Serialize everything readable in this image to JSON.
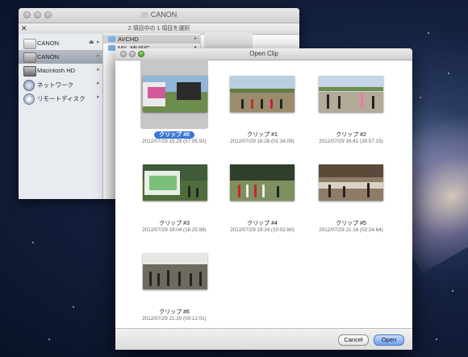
{
  "finder": {
    "title": "CANON",
    "status_text": "2 項目中の 1 項目を選択",
    "sidebar": [
      {
        "label": "CANON",
        "icon": "drive-icon",
        "eject": "⏏"
      },
      {
        "label": "CANON",
        "icon": "drive-icon"
      },
      {
        "label": "Macintosh HD",
        "icon": "hard-disk-icon"
      },
      {
        "label": "ネットワーク",
        "icon": "network-icon"
      },
      {
        "label": "リモートディスク",
        "icon": "disc-icon"
      }
    ],
    "column_items": [
      {
        "label": "AVCHD"
      },
      {
        "label": "MY_MUSIC"
      }
    ]
  },
  "dialog": {
    "title": "Open Clip",
    "clips": [
      {
        "name": "クリップ #0",
        "meta": "2012/07/29 15:29 (57:05.92)"
      },
      {
        "name": "クリップ #1",
        "meta": "2012/07/29 16:28 (01:34.09)"
      },
      {
        "name": "クリップ #2",
        "meta": "2012/07/29 16:41 (35:57.15)"
      },
      {
        "name": "クリップ #3",
        "meta": "2012/07/29 19:04 (16:25.98)"
      },
      {
        "name": "クリップ #4",
        "meta": "2012/07/29 19:24 (10:02.60)"
      },
      {
        "name": "クリップ #5",
        "meta": "2012/07/29 21:16 (02:24.64)"
      },
      {
        "name": "クリップ #6",
        "meta": "2012/07/29 21:20 (00:12.01)"
      }
    ],
    "selected_index": 0,
    "cancel_label": "Cancel",
    "open_label": "Open"
  }
}
